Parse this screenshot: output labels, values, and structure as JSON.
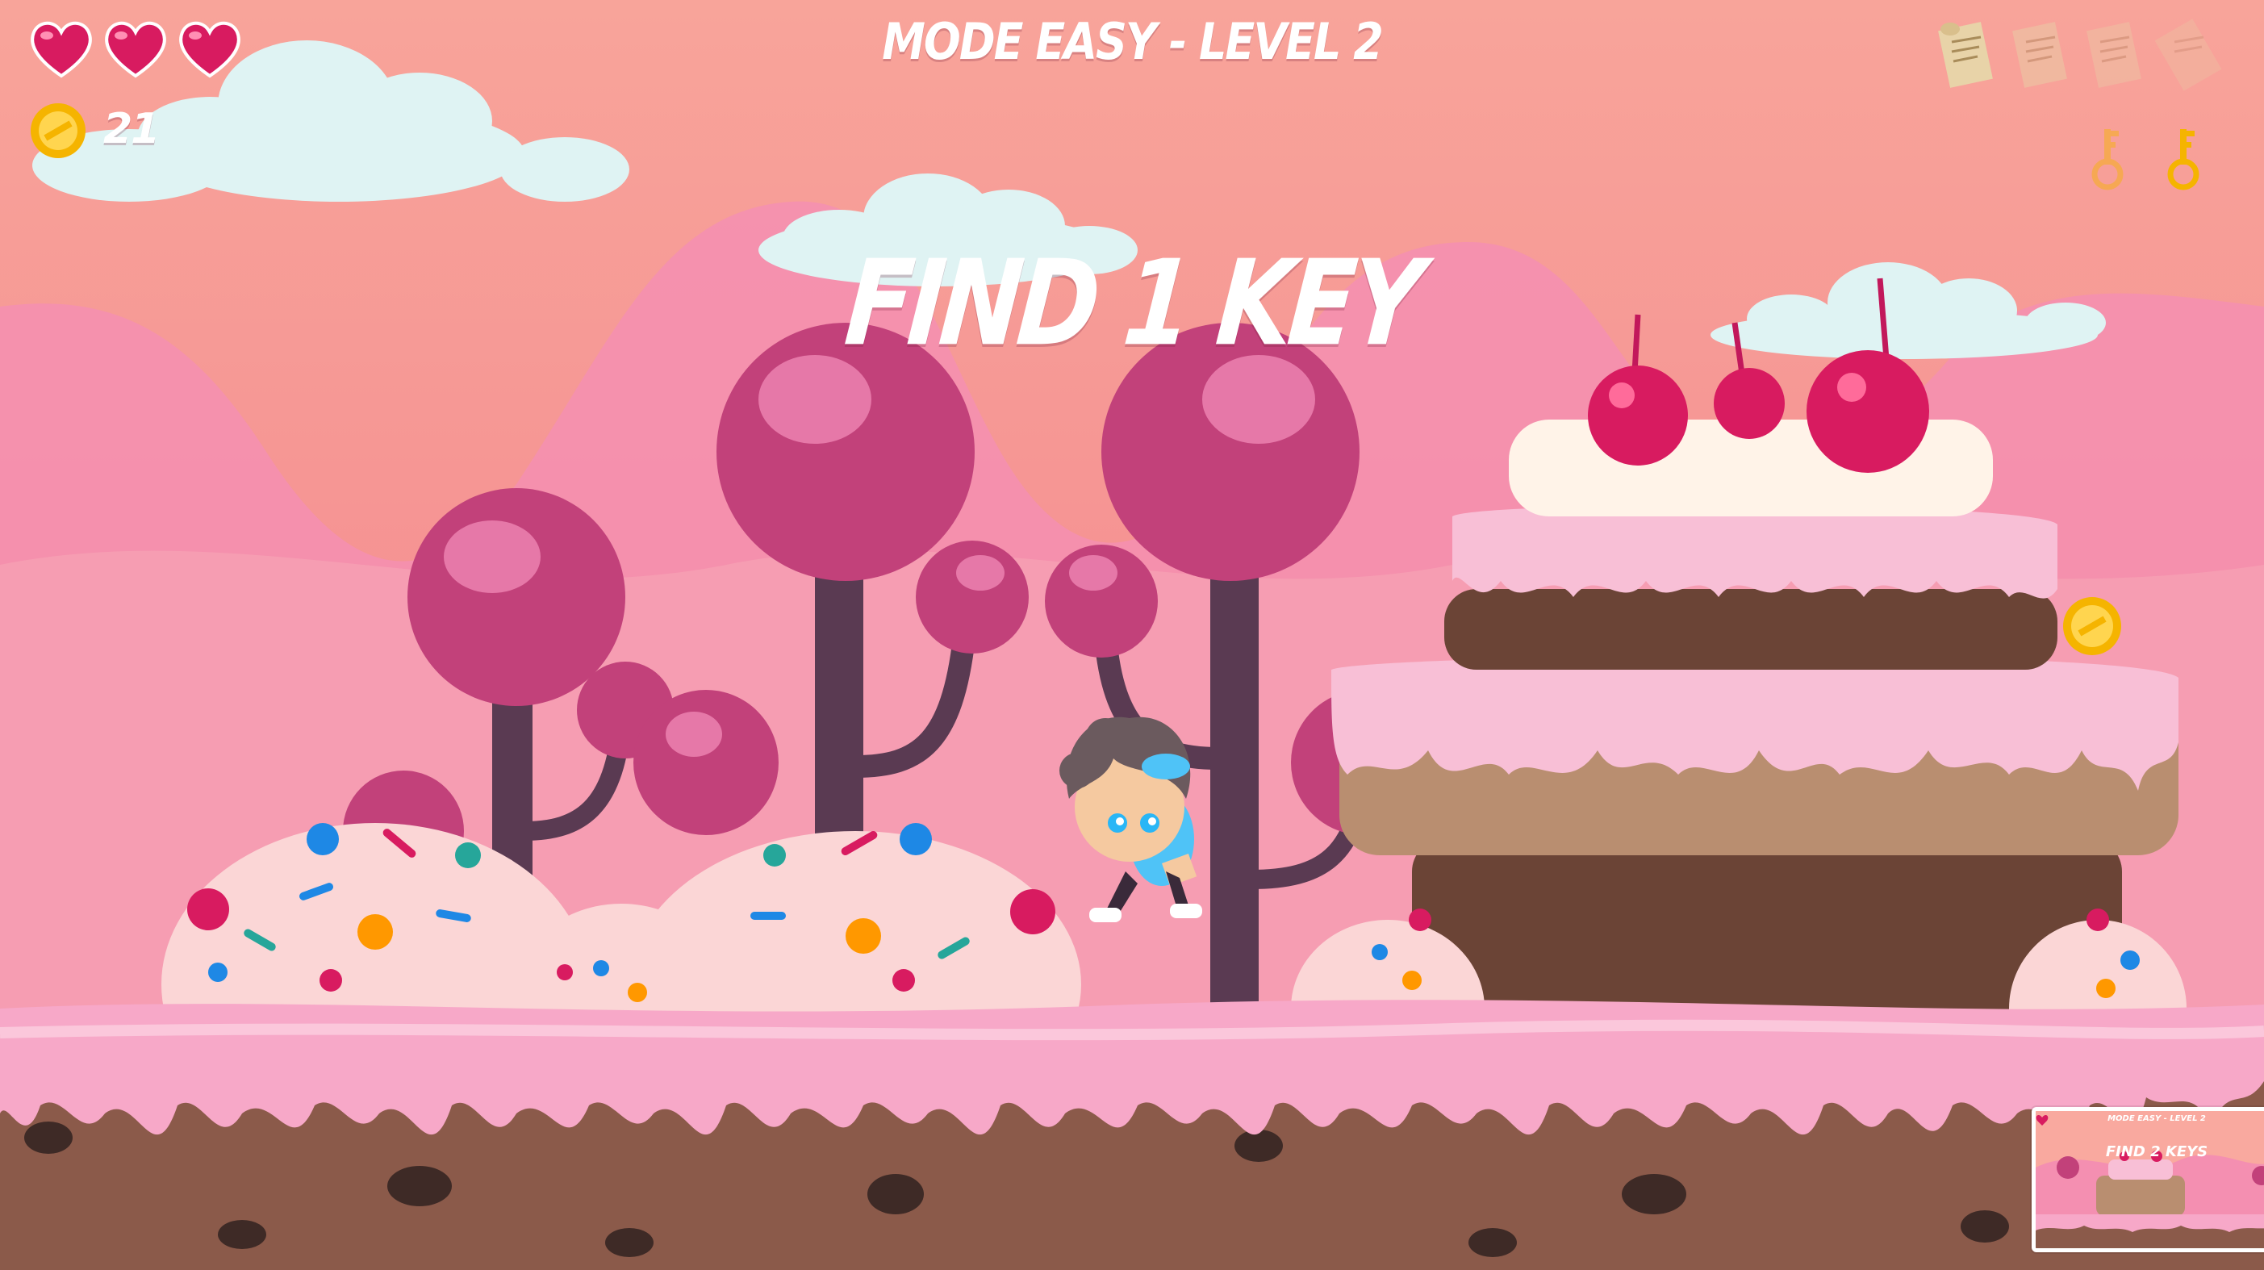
{
  "hud": {
    "title": "MODE EASY - LEVEL 2",
    "objective": "FIND 1 KEY",
    "lives": 3,
    "coins": "21",
    "heart_icon": "heart-icon",
    "coin_icon": "coin-icon",
    "scrolls": [
      {
        "name": "scroll-1",
        "collected": true
      },
      {
        "name": "scroll-2",
        "collected": false
      },
      {
        "name": "scroll-3",
        "collected": false
      },
      {
        "name": "scroll-4",
        "collected": false
      }
    ],
    "keys": [
      {
        "name": "key-1",
        "collected": false
      },
      {
        "name": "key-2",
        "collected": true
      }
    ]
  },
  "minimap": {
    "title": "MODE EASY - LEVEL 2",
    "objective": "FIND 2 KEYS"
  },
  "colors": {
    "sky": "#f9a99f",
    "hills": "#f48fb1",
    "frosting": "#f7a8c8",
    "chocolate": "#8b5a4a",
    "candy_tree": "#c2417a",
    "heart": "#d81b60",
    "coin": "#f5b400"
  }
}
